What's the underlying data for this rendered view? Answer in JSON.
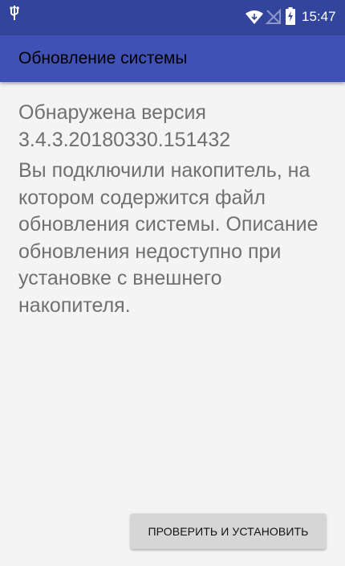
{
  "status_bar": {
    "time": "15:47",
    "icons": [
      "usb-icon",
      "wifi-icon",
      "signal-off-icon",
      "battery-charging-icon"
    ],
    "background_color": "#33449c"
  },
  "app_bar": {
    "title": "Обновление системы",
    "background_color": "#3f51b5"
  },
  "content": {
    "detected_label": "Обнаружена версия",
    "version": "3.4.3.20180330.151432",
    "message": "Вы подключили накопитель, на котором содержится файл обновления системы. Описание обновления недоступно при установке с внешнего накопителя."
  },
  "actions": {
    "install_button_label": "ПРОВЕРИТЬ И УСТАНОВИТЬ"
  }
}
